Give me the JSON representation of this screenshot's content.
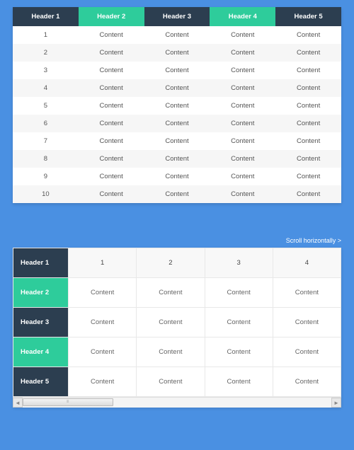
{
  "table1": {
    "headers": [
      {
        "label": "Header 1",
        "class": "dark"
      },
      {
        "label": "Header 2",
        "class": "teal"
      },
      {
        "label": "Header 3",
        "class": "dark"
      },
      {
        "label": "Header 4",
        "class": "teal"
      },
      {
        "label": "Header 5",
        "class": "dark"
      }
    ],
    "rows": [
      {
        "num": "1",
        "cells": [
          "Content",
          "Content",
          "Content",
          "Content"
        ]
      },
      {
        "num": "2",
        "cells": [
          "Content",
          "Content",
          "Content",
          "Content"
        ]
      },
      {
        "num": "3",
        "cells": [
          "Content",
          "Content",
          "Content",
          "Content"
        ]
      },
      {
        "num": "4",
        "cells": [
          "Content",
          "Content",
          "Content",
          "Content"
        ]
      },
      {
        "num": "5",
        "cells": [
          "Content",
          "Content",
          "Content",
          "Content"
        ]
      },
      {
        "num": "6",
        "cells": [
          "Content",
          "Content",
          "Content",
          "Content"
        ]
      },
      {
        "num": "7",
        "cells": [
          "Content",
          "Content",
          "Content",
          "Content"
        ]
      },
      {
        "num": "8",
        "cells": [
          "Content",
          "Content",
          "Content",
          "Content"
        ]
      },
      {
        "num": "9",
        "cells": [
          "Content",
          "Content",
          "Content",
          "Content"
        ]
      },
      {
        "num": "10",
        "cells": [
          "Content",
          "Content",
          "Content",
          "Content"
        ]
      }
    ]
  },
  "scroll_hint": "Scroll horizontally >",
  "table2": {
    "rowHeaders": [
      {
        "label": "Header 1",
        "class": "dark"
      },
      {
        "label": "Header 2",
        "class": "teal"
      },
      {
        "label": "Header 3",
        "class": "dark"
      },
      {
        "label": "Header 4",
        "class": "teal"
      },
      {
        "label": "Header 5",
        "class": "dark"
      }
    ],
    "colHeaders": [
      "1",
      "2",
      "3",
      "4"
    ],
    "rows": [
      [
        "Content",
        "Content",
        "Content",
        "Content"
      ],
      [
        "Content",
        "Content",
        "Content",
        "Content"
      ],
      [
        "Content",
        "Content",
        "Content",
        "Content"
      ],
      [
        "Content",
        "Content",
        "Content",
        "Content"
      ]
    ]
  },
  "scrollbar": {
    "left_arrow": "◄",
    "right_arrow": "►",
    "grip": "≡"
  }
}
